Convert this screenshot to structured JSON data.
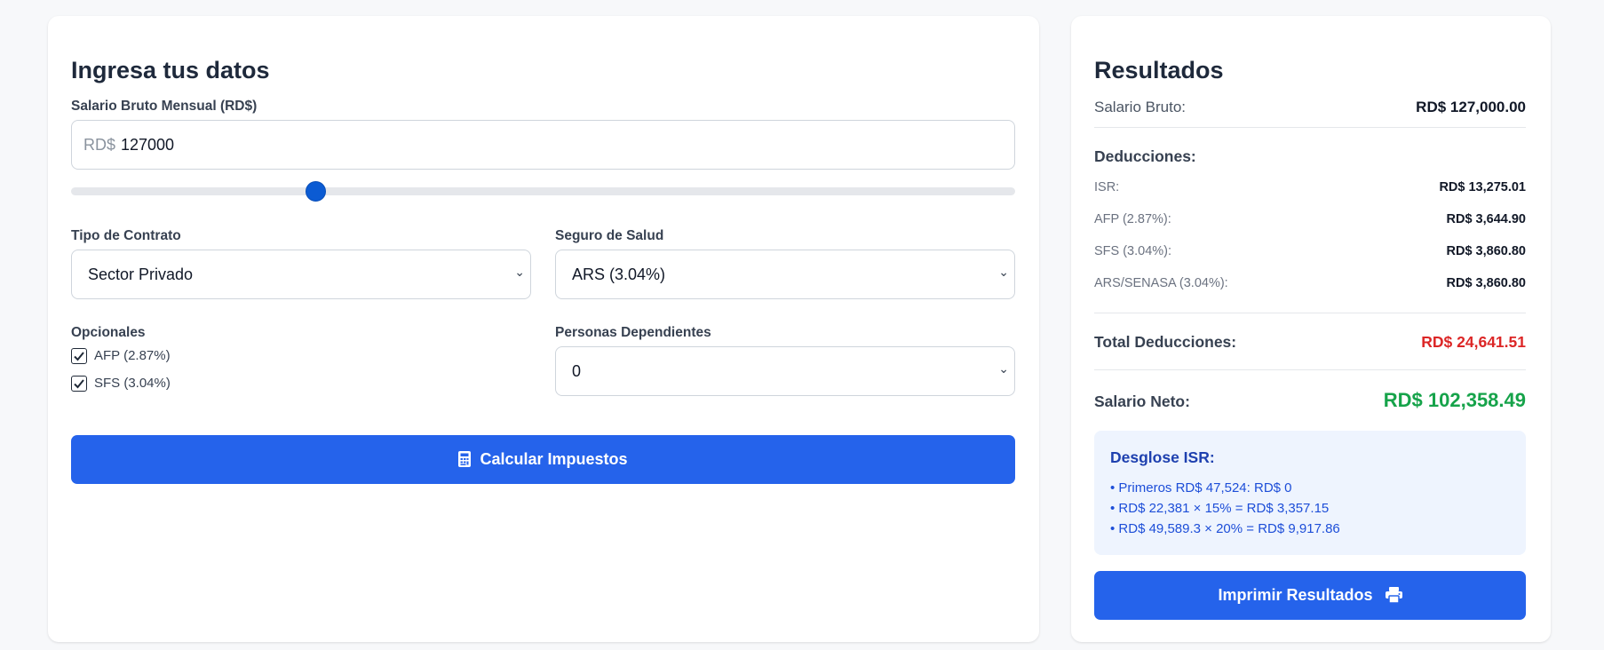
{
  "form": {
    "title": "Ingresa tus datos",
    "salary_label": "Salario Bruto Mensual (RD$)",
    "salary_prefix": "RD$",
    "salary_value": "127000",
    "contract_label": "Tipo de Contrato",
    "contract_value": "Sector Privado",
    "health_label": "Seguro de Salud",
    "health_value": "ARS (3.04%)",
    "optional_label": "Opcionales",
    "optional_items": [
      {
        "label": "AFP (2.87%)",
        "checked": true
      },
      {
        "label": "SFS (3.04%)",
        "checked": true
      }
    ],
    "dependents_label": "Personas Dependientes",
    "dependents_value": "0",
    "calculate_label": "Calcular Impuestos",
    "calculate_icon": "calculator-icon"
  },
  "results": {
    "title": "Resultados",
    "gross_label": "Salario Bruto:",
    "gross_value": "RD$ 127,000.00",
    "deductions_label": "Deducciones:",
    "deductions": [
      {
        "label": "ISR:",
        "value": "RD$ 13,275.01"
      },
      {
        "label": "AFP (2.87%):",
        "value": "RD$ 3,644.90"
      },
      {
        "label": "SFS (3.04%):",
        "value": "RD$ 3,860.80"
      },
      {
        "label": "ARS/SENASA (3.04%):",
        "value": "RD$ 3,860.80"
      }
    ],
    "total_label": "Total Deducciones:",
    "total_value": "RD$ 24,641.51",
    "net_label": "Salario Neto:",
    "net_value": "RD$ 102,358.49",
    "isr_title": "Desglose ISR:",
    "isr_lines": [
      "• Primeros RD$ 47,524: RD$ 0",
      "• RD$ 22,381 × 15% = RD$ 3,357.15",
      "• RD$ 49,589.3 × 20% = RD$ 9,917.86"
    ],
    "print_label": "Imprimir Resultados",
    "print_icon": "printer-icon"
  },
  "colors": {
    "primary": "#2563eb",
    "total_red": "#dc2626",
    "net_green": "#16a34a",
    "slider_thumb": "#0b5bd3"
  }
}
